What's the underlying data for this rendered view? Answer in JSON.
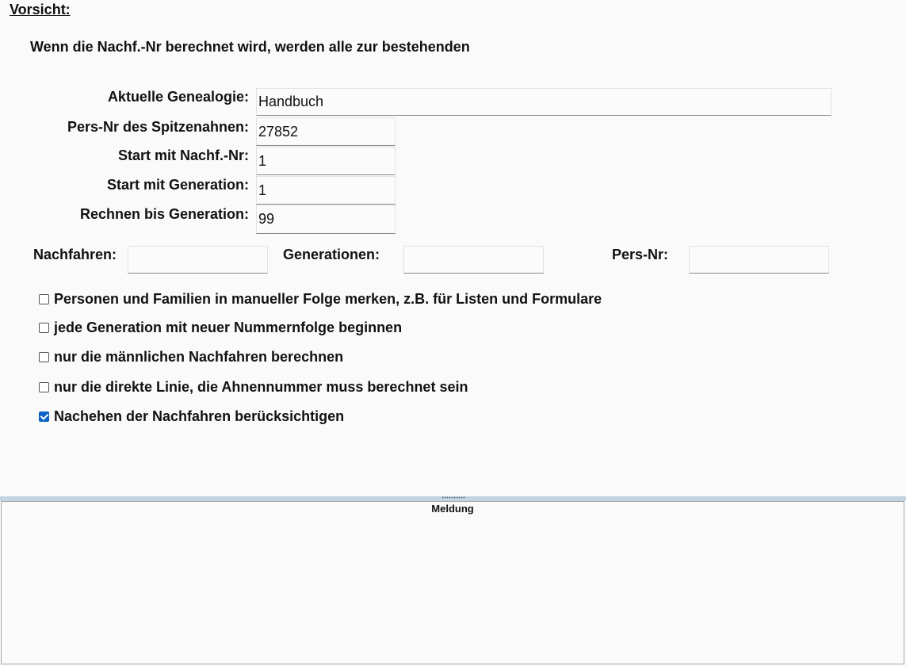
{
  "warning": {
    "title": "Vorsicht:",
    "text": "Wenn die Nachf.-Nr berechnet wird, werden alle zur bestehenden"
  },
  "fields": {
    "genealogy": {
      "label": "Aktuelle Genealogie:",
      "value": "Handbuch"
    },
    "pers_nr": {
      "label": "Pers-Nr des Spitzenahnen:",
      "value": "27852"
    },
    "start_nachf": {
      "label": "Start mit Nachf.-Nr:",
      "value": "1"
    },
    "start_gen": {
      "label": "Start mit Generation:",
      "value": "1"
    },
    "calc_until": {
      "label": "Rechnen bis Generation:",
      "value": "99"
    }
  },
  "stats": {
    "nachfahren": {
      "label": "Nachfahren:",
      "value": ""
    },
    "generationen": {
      "label": "Generationen:",
      "value": ""
    },
    "pers_nr": {
      "label": "Pers-Nr:",
      "value": ""
    }
  },
  "options": [
    {
      "label": "Personen und Familien in manueller Folge merken, z.B. für Listen und Formulare",
      "checked": false
    },
    {
      "label": "jede Generation mit neuer Nummernfolge beginnen",
      "checked": false
    },
    {
      "label": "nur die männlichen Nachfahren berechnen",
      "checked": false
    },
    {
      "label": "nur die direkte Linie, die Ahnennummer muss berechnet sein",
      "checked": false
    },
    {
      "label": "Nachehen der Nachfahren berücksichtigen",
      "checked": true
    }
  ],
  "message_panel": {
    "title": "Meldung"
  },
  "colors": {
    "accent": "#0b63c7",
    "splitter": "#c4d3e2"
  }
}
